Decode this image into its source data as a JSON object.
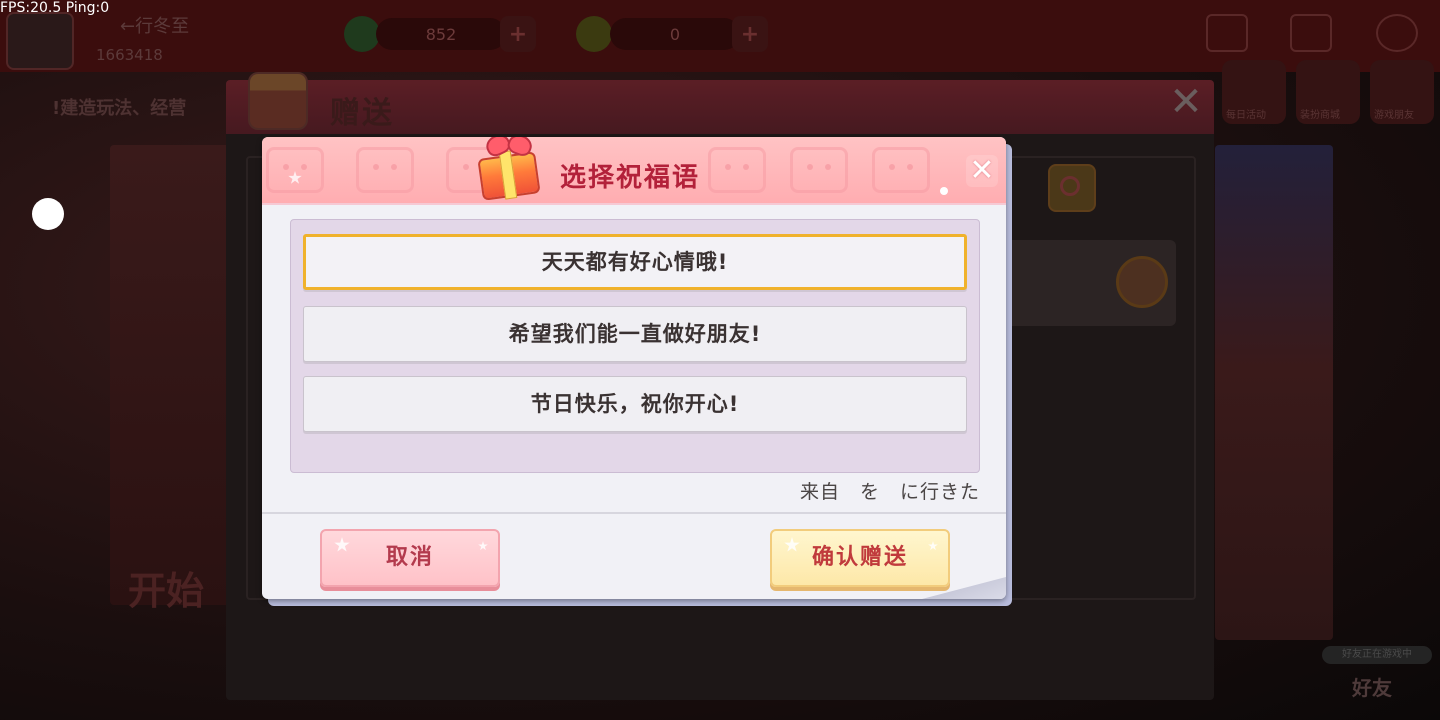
{
  "hud": {
    "fps": "FPS:20.5  Ping:0",
    "player_name": "←行冬至",
    "player_id": "1663418",
    "currency_a": "852",
    "currency_b": "0",
    "notice": "!建造玩法、经营",
    "tools": [
      "每日活动",
      "装扮商城",
      "游戏朋友"
    ],
    "start_label": "开始",
    "friend_tag": "好友正在游戏中",
    "friend_label": "好友"
  },
  "gift_panel": {
    "title": "赠送",
    "close_icon": "close-icon"
  },
  "dialog": {
    "title": "选择祝福语",
    "close_glyph": "✕",
    "options": [
      {
        "label": "天天都有好心情哦!",
        "selected": true
      },
      {
        "label": "希望我们能一直做好朋友!",
        "selected": false
      },
      {
        "label": "节日快乐，祝你开心!",
        "selected": false
      }
    ],
    "from_line": "来自　を　に行きた",
    "cancel_label": "取消",
    "confirm_label": "确认赠送"
  },
  "colors": {
    "accent_red": "#b3213a",
    "selected_border": "#f0b22c",
    "cancel_bg": "#ffc2c8",
    "confirm_bg": "#fde8a8"
  }
}
